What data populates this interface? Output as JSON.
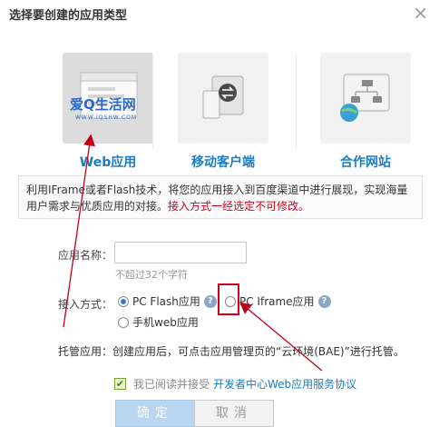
{
  "dialog": {
    "title": "选择要创建的应用类型",
    "close_glyph": "×"
  },
  "app_types": [
    {
      "label": "Web应用",
      "selected": true,
      "watermark": "爱Q生活网",
      "watermark_url": "WWW.IQSHW.COM"
    },
    {
      "label": "移动客户端",
      "selected": false
    },
    {
      "label": "合作网站",
      "selected": false
    }
  ],
  "description": {
    "text": "利用IFrame或者Flash技术，将您的应用接入到百度渠道中进行展现，实现海量用户需求与优质应用的对接。",
    "warning": "接入方式一经选定不可修改。"
  },
  "form": {
    "app_name_label": "应用名称：",
    "app_name_value": "",
    "app_name_hint": "不超过32个字符",
    "access_label": "接入方式：",
    "access_options": [
      {
        "label": "PC Flash应用",
        "checked": true,
        "help": "?"
      },
      {
        "label": "PC Iframe应用",
        "checked": false,
        "help": "?"
      },
      {
        "label": "手机web应用",
        "checked": false,
        "help": "?"
      }
    ],
    "hosting_text": "托管应用：创建应用后，可点击应用管理页的“云环境(BAE)”进行托管。",
    "agree_checked": true,
    "agree_text": "我已阅读并接受",
    "agree_link": "开发者中心Web应用服务协议"
  },
  "buttons": {
    "ok": "确定",
    "cancel": "取消"
  },
  "colors": {
    "accent": "#1a7cc4",
    "warning": "#d0021b",
    "annotation": "#c0001a"
  }
}
